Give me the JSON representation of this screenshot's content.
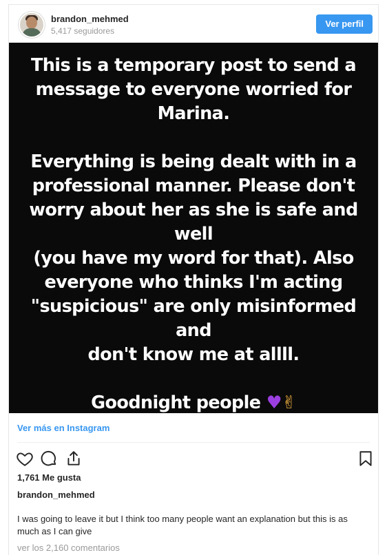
{
  "header": {
    "username": "brandon_mehmed",
    "followers": "5,417 seguidores",
    "view_profile_label": "Ver perfil",
    "accent_color": "#3897f0"
  },
  "post": {
    "text_lines": [
      "This is a temporary post to send a",
      "message to everyone worried for",
      "Marina.",
      "",
      "Everything is being dealt with in a",
      "professional manner. Please don't",
      "worry about her as she is safe and well",
      "(you have my word for that). Also",
      "everyone who thinks I'm acting",
      "\"suspicious\" are only misinformed and",
      "don't know me at allll.",
      "",
      "Goodnight people"
    ],
    "emojis": [
      "purple-heart",
      "victory-hand"
    ],
    "background_color": "#0b0a0b"
  },
  "view_more_label": "Ver más en Instagram",
  "actions": {
    "icons": [
      "heart-icon",
      "comment-icon",
      "share-icon",
      "bookmark-icon"
    ]
  },
  "likes": "1,761 Me gusta",
  "caption": {
    "username": "brandon_mehmed",
    "text": "I was going to leave it but I think too many people want an explanation but this is as much as I can give"
  },
  "comments_label": "ver los 2,160 comentarios"
}
